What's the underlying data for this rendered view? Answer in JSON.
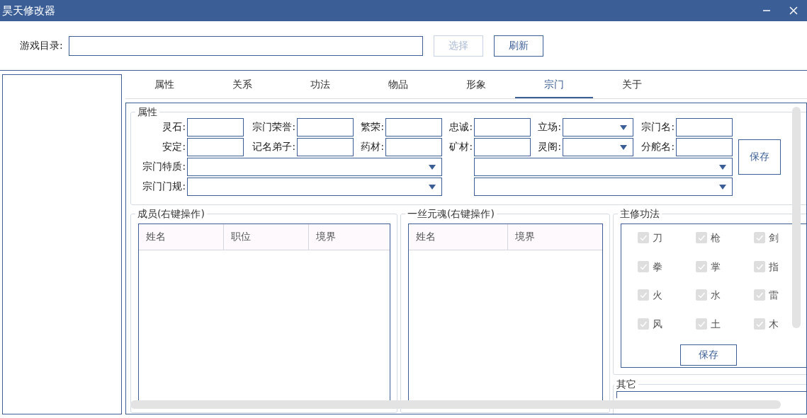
{
  "window": {
    "title": "昊天修改器"
  },
  "game_dir": {
    "label": "游戏目录:"
  },
  "buttons": [
    {
      "label": "选择",
      "disabled": true
    },
    {
      "label": "刷新",
      "disabled": false
    }
  ],
  "tabs": [
    {
      "label": "属性",
      "selected": false
    },
    {
      "label": "关系",
      "selected": false
    },
    {
      "label": "功法",
      "selected": false
    },
    {
      "label": "物品",
      "selected": false
    },
    {
      "label": "形象",
      "selected": false
    },
    {
      "label": "宗门",
      "selected": true
    },
    {
      "label": "关于",
      "selected": false
    }
  ],
  "attributes": {
    "title": "属性",
    "rows": [
      [
        {
          "label": "灵石:",
          "kind": "text"
        },
        {
          "label": "宗门荣誉:",
          "kind": "text"
        },
        {
          "label": "繁荣:",
          "kind": "text"
        },
        {
          "label": "忠诚:",
          "kind": "text"
        },
        {
          "label": "立场:",
          "kind": "combo"
        },
        {
          "label": "宗门名:",
          "kind": "text"
        }
      ],
      [
        {
          "label": "安定:",
          "kind": "text"
        },
        {
          "label": "记名弟子:",
          "kind": "text"
        },
        {
          "label": "药材:",
          "kind": "text"
        },
        {
          "label": "矿材:",
          "kind": "text"
        },
        {
          "label": "灵阁:",
          "kind": "combo"
        },
        {
          "label": "分舵名:",
          "kind": "text"
        }
      ]
    ],
    "wide_rows": [
      [
        {
          "label": "宗门特质:",
          "kind": "combo"
        },
        {
          "kind": "combo"
        }
      ],
      [
        {
          "label": "宗门门规:",
          "kind": "combo"
        },
        {
          "kind": "combo"
        }
      ]
    ],
    "save_button": "保存"
  },
  "members": {
    "title": "成员(右键操作)",
    "columns": [
      "姓名",
      "职位",
      "境界"
    ]
  },
  "souls": {
    "title": "一丝元魂(右键操作)",
    "columns": [
      "姓名",
      "境界"
    ]
  },
  "techniques": {
    "title": "主修功法",
    "options": [
      {
        "label": "刀",
        "checked": true,
        "disabled": true
      },
      {
        "label": "枪",
        "checked": true,
        "disabled": true
      },
      {
        "label": "剑",
        "checked": true,
        "disabled": true
      },
      {
        "label": "拳",
        "checked": true,
        "disabled": true
      },
      {
        "label": "掌",
        "checked": true,
        "disabled": true
      },
      {
        "label": "指",
        "checked": true,
        "disabled": true
      },
      {
        "label": "火",
        "checked": true,
        "disabled": true
      },
      {
        "label": "水",
        "checked": true,
        "disabled": true
      },
      {
        "label": "雷",
        "checked": true,
        "disabled": true
      },
      {
        "label": "风",
        "checked": true,
        "disabled": true
      },
      {
        "label": "土",
        "checked": true,
        "disabled": true
      },
      {
        "label": "木",
        "checked": true,
        "disabled": true
      }
    ],
    "save_button": "保存"
  },
  "other": {
    "title": "其它"
  }
}
